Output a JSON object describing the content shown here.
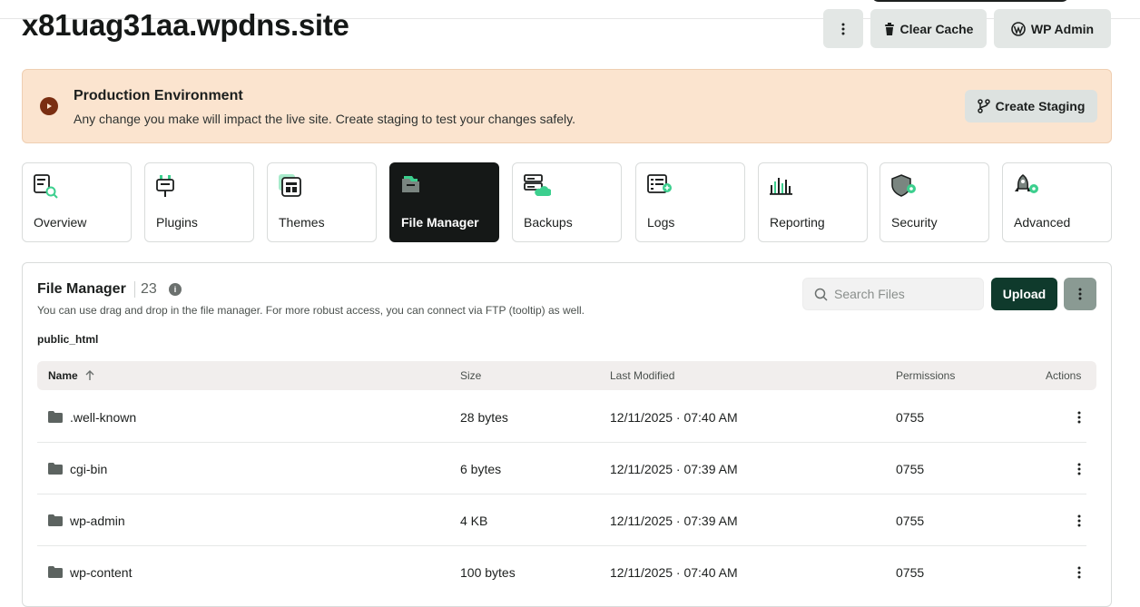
{
  "header": {
    "site_title": "x81uag31aa.wpdns.site",
    "menu_icon": "vertical-dots-icon",
    "clear_cache_label": "Clear Cache",
    "wp_admin_label": "WP Admin"
  },
  "environment": {
    "title": "Production Environment",
    "description": "Any change you make will impact the live site. Create staging to test your changes safely.",
    "create_staging_label": "Create Staging",
    "accent": "#7a2e12",
    "background": "#fbe4cf"
  },
  "nav": {
    "tabs": [
      {
        "label": "Overview",
        "icon": "overview-icon",
        "active": false
      },
      {
        "label": "Plugins",
        "icon": "plug-icon",
        "active": false
      },
      {
        "label": "Themes",
        "icon": "theme-icon",
        "active": false
      },
      {
        "label": "File Manager",
        "icon": "folder-icon",
        "active": true
      },
      {
        "label": "Backups",
        "icon": "server-cloud-icon",
        "active": false
      },
      {
        "label": "Logs",
        "icon": "logs-icon",
        "active": false
      },
      {
        "label": "Reporting",
        "icon": "bar-chart-icon",
        "active": false
      },
      {
        "label": "Security",
        "icon": "shield-icon",
        "active": false
      },
      {
        "label": "Advanced",
        "icon": "rocket-gear-icon",
        "active": false
      }
    ]
  },
  "file_manager": {
    "title": "File Manager",
    "count": "23",
    "description": "You can use drag and drop in the file manager. For more robust access, you can connect via FTP (tooltip) as well.",
    "path": "public_html",
    "search_placeholder": "Search Files",
    "upload_label": "Upload",
    "columns": {
      "name": "Name",
      "size": "Size",
      "last_modified": "Last Modified",
      "permissions": "Permissions",
      "actions": "Actions"
    },
    "rows": [
      {
        "name": ".well-known",
        "size": "28 bytes",
        "modified": "12/11/2025 · 07:40 AM",
        "permissions": "0755"
      },
      {
        "name": "cgi-bin",
        "size": "6 bytes",
        "modified": "12/11/2025 · 07:39 AM",
        "permissions": "0755"
      },
      {
        "name": "wp-admin",
        "size": "4 KB",
        "modified": "12/11/2025 · 07:39 AM",
        "permissions": "0755"
      },
      {
        "name": "wp-content",
        "size": "100 bytes",
        "modified": "12/11/2025 · 07:40 AM",
        "permissions": "0755"
      }
    ],
    "primary_color": "#0f3a2c",
    "icon_accent": "#3ccf8e"
  }
}
